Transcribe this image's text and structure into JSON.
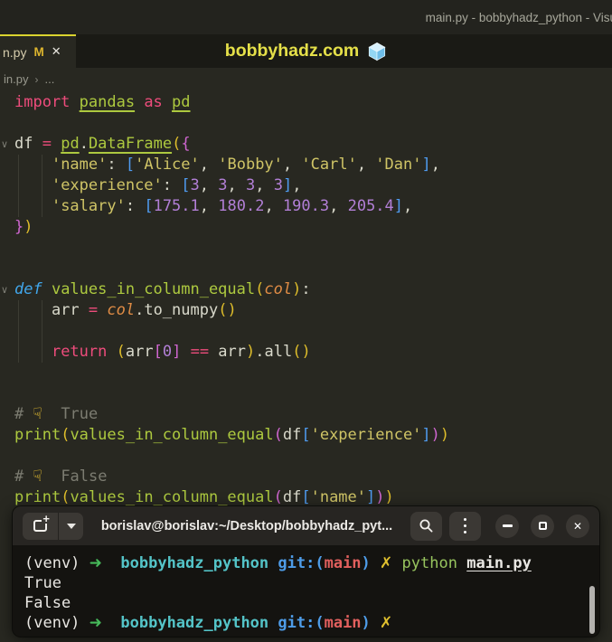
{
  "titlebar": {
    "window_title": "main.py - bobbyhadz_python - Visu"
  },
  "tabbar": {
    "active_tab": {
      "label": "n.py",
      "modified_badge": "M",
      "close_icon": "✕"
    },
    "watermark": {
      "text": "bobbyhadz.com",
      "icon": "ice-cube-emoji"
    }
  },
  "breadcrumb": {
    "file": "in.py",
    "separator": "›",
    "ellipsis": "..."
  },
  "colors": {
    "editor_background": "#282821",
    "tab_accent_yellow": "#d9d32f",
    "watermark_yellow": "#e5e049",
    "keyword_pink": "#ee4c7c",
    "function_green": "#adc93f",
    "string_olive": "#cfc466",
    "number_purple": "#b27fd6",
    "bracket_yellow": "#debd2b",
    "bracket_magenta": "#cf66d0",
    "bracket_blue": "#4f9bf0",
    "def_blue_italic": "#41a7ec",
    "param_orange_italic": "#e08c45",
    "terminal_background": "#141310",
    "terminal_header": "#272522",
    "prompt_arrow_green": "#46b95a",
    "prompt_dir_cyan": "#54c4c8",
    "git_blue": "#4e9ce8",
    "git_branch_red": "#e2605e",
    "dirty_x_yellow": "#e0c02e"
  },
  "editor": {
    "fold_icon": "∨",
    "lines": [
      {
        "tokens": [
          {
            "c": "kw",
            "t": "import "
          },
          {
            "c": "im",
            "t": "pandas"
          },
          {
            "c": "kw",
            "t": " as "
          },
          {
            "c": "im",
            "t": "pd"
          }
        ]
      },
      {
        "tokens": []
      },
      {
        "fold": true,
        "tokens": [
          {
            "c": "p",
            "t": "df "
          },
          {
            "c": "kw",
            "t": "= "
          },
          {
            "c": "im",
            "t": "pd"
          },
          {
            "c": "p",
            "t": "."
          },
          {
            "c": "im",
            "t": "DataFrame"
          },
          {
            "c": "b1",
            "t": "("
          },
          {
            "c": "b2",
            "t": "{"
          }
        ]
      },
      {
        "guides": [
          20,
          46
        ],
        "tokens": [
          {
            "c": "p",
            "t": "    "
          },
          {
            "c": "s",
            "t": "'name'"
          },
          {
            "c": "p",
            "t": ": "
          },
          {
            "c": "b3",
            "t": "["
          },
          {
            "c": "s",
            "t": "'Alice'"
          },
          {
            "c": "p",
            "t": ", "
          },
          {
            "c": "s",
            "t": "'Bobby'"
          },
          {
            "c": "p",
            "t": ", "
          },
          {
            "c": "s",
            "t": "'Carl'"
          },
          {
            "c": "p",
            "t": ", "
          },
          {
            "c": "s",
            "t": "'Dan'"
          },
          {
            "c": "b3",
            "t": "]"
          },
          {
            "c": "p",
            "t": ","
          }
        ]
      },
      {
        "guides": [
          20,
          46
        ],
        "tokens": [
          {
            "c": "p",
            "t": "    "
          },
          {
            "c": "s",
            "t": "'experience'"
          },
          {
            "c": "p",
            "t": ": "
          },
          {
            "c": "b3",
            "t": "["
          },
          {
            "c": "n",
            "t": "3"
          },
          {
            "c": "p",
            "t": ", "
          },
          {
            "c": "n",
            "t": "3"
          },
          {
            "c": "p",
            "t": ", "
          },
          {
            "c": "n",
            "t": "3"
          },
          {
            "c": "p",
            "t": ", "
          },
          {
            "c": "n",
            "t": "3"
          },
          {
            "c": "b3",
            "t": "]"
          },
          {
            "c": "p",
            "t": ","
          }
        ]
      },
      {
        "guides": [
          20,
          46
        ],
        "tokens": [
          {
            "c": "p",
            "t": "    "
          },
          {
            "c": "s",
            "t": "'salary'"
          },
          {
            "c": "p",
            "t": ": "
          },
          {
            "c": "b3",
            "t": "["
          },
          {
            "c": "n",
            "t": "175.1"
          },
          {
            "c": "p",
            "t": ", "
          },
          {
            "c": "n",
            "t": "180.2"
          },
          {
            "c": "p",
            "t": ", "
          },
          {
            "c": "n",
            "t": "190.3"
          },
          {
            "c": "p",
            "t": ", "
          },
          {
            "c": "n",
            "t": "205.4"
          },
          {
            "c": "b3",
            "t": "]"
          },
          {
            "c": "p",
            "t": ","
          }
        ]
      },
      {
        "tokens": [
          {
            "c": "b2",
            "t": "}"
          },
          {
            "c": "b1",
            "t": ")"
          }
        ]
      },
      {
        "tokens": []
      },
      {
        "tokens": []
      },
      {
        "fold": true,
        "tokens": [
          {
            "c": "dk",
            "t": "def "
          },
          {
            "c": "fn",
            "t": "values_in_column_equal"
          },
          {
            "c": "b1",
            "t": "("
          },
          {
            "c": "pa",
            "t": "col"
          },
          {
            "c": "b1",
            "t": ")"
          },
          {
            "c": "p",
            "t": ":"
          }
        ]
      },
      {
        "guides": [
          20,
          46
        ],
        "tokens": [
          {
            "c": "p",
            "t": "    arr "
          },
          {
            "c": "kw",
            "t": "= "
          },
          {
            "c": "pa",
            "t": "col"
          },
          {
            "c": "p",
            "t": ".to_numpy"
          },
          {
            "c": "b1",
            "t": "()"
          }
        ]
      },
      {
        "guides": [
          20,
          46
        ],
        "tokens": []
      },
      {
        "guides": [
          20,
          46
        ],
        "tokens": [
          {
            "c": "p",
            "t": "    "
          },
          {
            "c": "kw",
            "t": "return "
          },
          {
            "c": "b1",
            "t": "("
          },
          {
            "c": "p",
            "t": "arr"
          },
          {
            "c": "b2",
            "t": "["
          },
          {
            "c": "n",
            "t": "0"
          },
          {
            "c": "b2",
            "t": "]"
          },
          {
            "c": "p",
            "t": " "
          },
          {
            "c": "kw",
            "t": "=="
          },
          {
            "c": "p",
            "t": " arr"
          },
          {
            "c": "b1",
            "t": ")"
          },
          {
            "c": "p",
            "t": ".all"
          },
          {
            "c": "b1",
            "t": "()"
          }
        ]
      },
      {
        "tokens": []
      },
      {
        "tokens": []
      },
      {
        "tokens": [
          {
            "c": "c",
            "t": "# "
          },
          {
            "c": "e",
            "t": "☟"
          },
          {
            "c": "c",
            "t": "  True"
          }
        ]
      },
      {
        "tokens": [
          {
            "c": "fn",
            "t": "print"
          },
          {
            "c": "b1",
            "t": "("
          },
          {
            "c": "fn",
            "t": "values_in_column_equal"
          },
          {
            "c": "b2",
            "t": "("
          },
          {
            "c": "p",
            "t": "df"
          },
          {
            "c": "b3",
            "t": "["
          },
          {
            "c": "s",
            "t": "'experience'"
          },
          {
            "c": "b3",
            "t": "]"
          },
          {
            "c": "b2",
            "t": ")"
          },
          {
            "c": "b1",
            "t": ")"
          }
        ]
      },
      {
        "tokens": []
      },
      {
        "tokens": [
          {
            "c": "c",
            "t": "# "
          },
          {
            "c": "e",
            "t": "☟"
          },
          {
            "c": "c",
            "t": "  False"
          }
        ]
      },
      {
        "tokens": [
          {
            "c": "fn",
            "t": "print"
          },
          {
            "c": "b1",
            "t": "("
          },
          {
            "c": "fn",
            "t": "values_in_column_equal"
          },
          {
            "c": "b2",
            "t": "("
          },
          {
            "c": "p",
            "t": "df"
          },
          {
            "c": "b3",
            "t": "["
          },
          {
            "c": "s",
            "t": "'name'"
          },
          {
            "c": "b3",
            "t": "]"
          },
          {
            "c": "b2",
            "t": ")"
          },
          {
            "c": "b1",
            "t": ")"
          }
        ]
      }
    ]
  },
  "terminal": {
    "header": {
      "title": "borislav@borislav:~/Desktop/bobbyhadz_pyt..."
    },
    "lines": [
      {
        "tokens": [
          {
            "c": "w",
            "t": "(venv) "
          },
          {
            "c": "ar",
            "t": "➜"
          },
          {
            "c": "w",
            "t": "  "
          },
          {
            "c": "cy",
            "t": "bobbyhadz_python"
          },
          {
            "c": "w",
            "t": " "
          },
          {
            "c": "gb",
            "t": "git:("
          },
          {
            "c": "rd",
            "t": "main"
          },
          {
            "c": "gb",
            "t": ")"
          },
          {
            "c": "w",
            "t": " "
          },
          {
            "c": "yx",
            "t": "✗"
          },
          {
            "c": "w",
            "t": " "
          },
          {
            "c": "gr",
            "t": "python"
          },
          {
            "c": "w",
            "t": " "
          },
          {
            "c": "wu",
            "t": "main.py"
          }
        ]
      },
      {
        "tokens": [
          {
            "c": "w",
            "t": "True"
          }
        ]
      },
      {
        "tokens": [
          {
            "c": "w",
            "t": "False"
          }
        ]
      },
      {
        "tokens": [
          {
            "c": "w",
            "t": "(venv) "
          },
          {
            "c": "ar",
            "t": "➜"
          },
          {
            "c": "w",
            "t": "  "
          },
          {
            "c": "cy",
            "t": "bobbyhadz_python"
          },
          {
            "c": "w",
            "t": " "
          },
          {
            "c": "gb",
            "t": "git:("
          },
          {
            "c": "rd",
            "t": "main"
          },
          {
            "c": "gb",
            "t": ")"
          },
          {
            "c": "w",
            "t": " "
          },
          {
            "c": "yx",
            "t": "✗"
          }
        ]
      }
    ]
  }
}
